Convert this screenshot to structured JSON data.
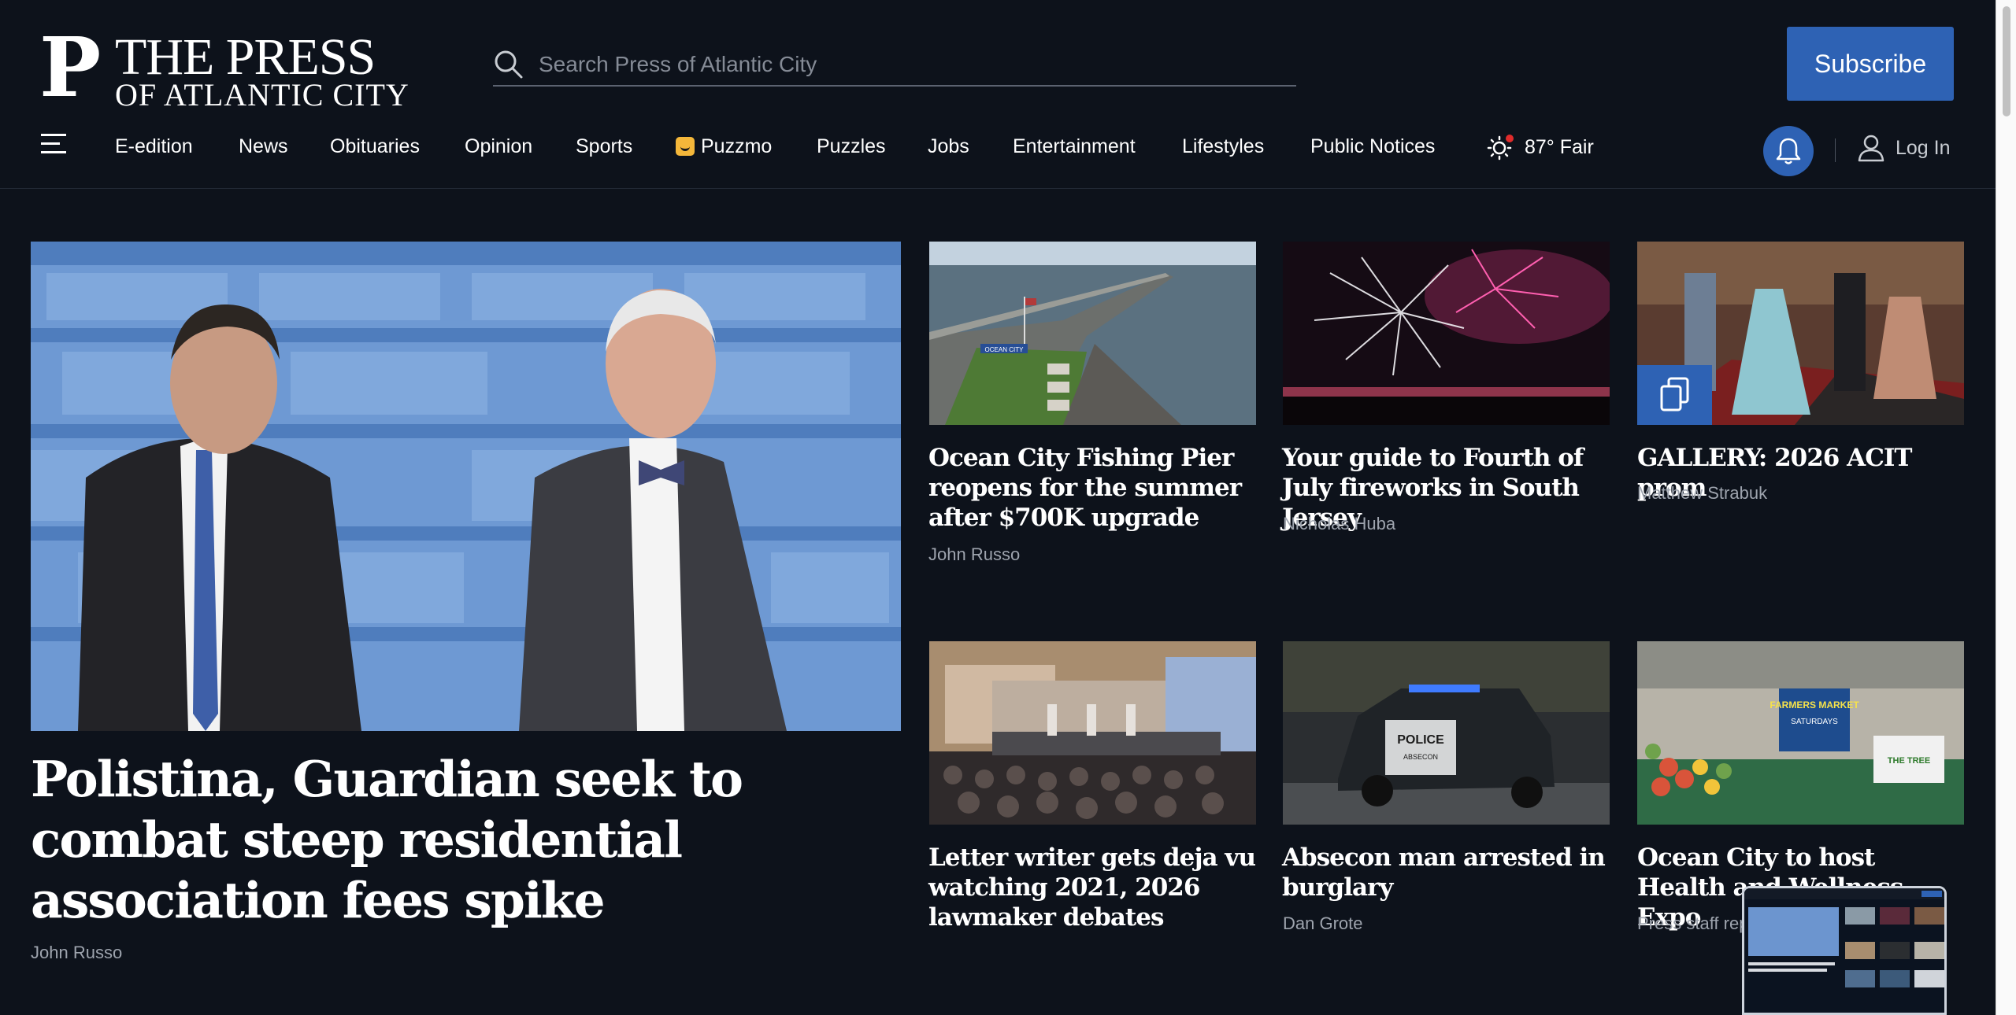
{
  "brand": {
    "logo_mark": "P",
    "logo_line1": "THE PRESS",
    "logo_line2": "OF ATLANTIC CITY"
  },
  "search": {
    "placeholder": "Search Press of Atlantic City"
  },
  "header": {
    "subscribe_label": "Subscribe"
  },
  "nav": {
    "items": [
      {
        "label": "E-edition"
      },
      {
        "label": "News"
      },
      {
        "label": "Obituaries"
      },
      {
        "label": "Opinion"
      },
      {
        "label": "Sports"
      },
      {
        "label": "Puzzmo"
      },
      {
        "label": "Puzzles"
      },
      {
        "label": "Jobs"
      },
      {
        "label": "Entertainment"
      },
      {
        "label": "Lifestyles"
      },
      {
        "label": "Public Notices"
      }
    ],
    "weather": "87° Fair",
    "login_label": "Log In"
  },
  "hero": {
    "title": "Polistina, Guardian seek to combat steep residential association fees spike",
    "author": "John Russo"
  },
  "stories": [
    {
      "title": "Ocean City Fishing Pier reopens for the summer after $700K upgrade",
      "author": "John Russo"
    },
    {
      "title": "Your guide to Fourth of July fireworks in South Jersey",
      "author": "Nicholas Huba"
    },
    {
      "title": "GALLERY: 2026 ACIT prom",
      "author": "Matthew Strabuk"
    },
    {
      "title": "Letter writer gets deja vu watching 2021, 2026 lawmaker debates",
      "author": ""
    },
    {
      "title": "Absecon man arrested in burglary",
      "author": "Dan Grote"
    },
    {
      "title": "Ocean City to host Health and Wellness Expo",
      "author": "Press staff report"
    }
  ],
  "image_text": {
    "pier_sign": "OCEAN CITY",
    "police_car": "POLICE",
    "police_car_sub": "ABSECON",
    "market_sign": "FARMERS MARKET",
    "market_sub": "SATURDAYS",
    "market_sign2": "THE TREE"
  },
  "colors": {
    "background": "#0d121b",
    "accent": "#2e62b4",
    "muted_text": "#9ea4ae"
  }
}
